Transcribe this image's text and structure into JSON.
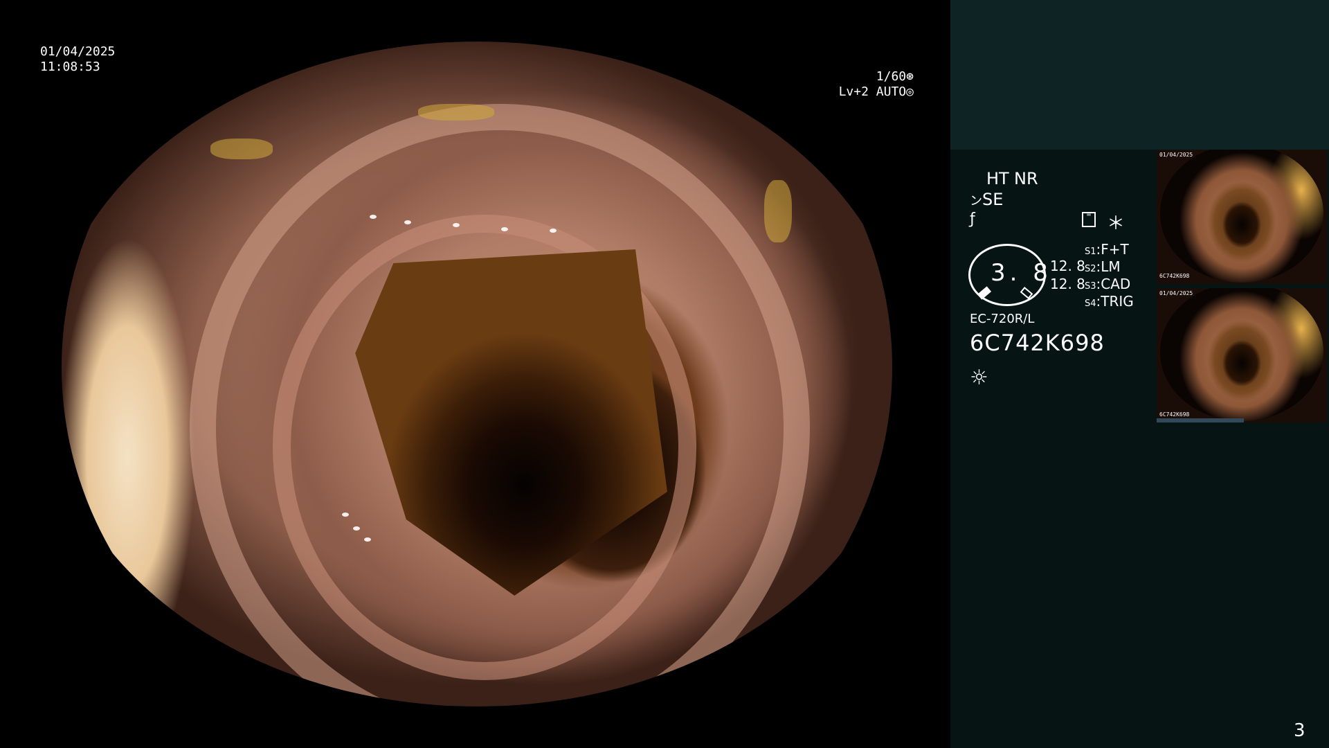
{
  "overlay": {
    "date": "01/04/2025",
    "time": "11:08:53",
    "shutter": "1/60",
    "shutter_icon": "aperture-icon",
    "exposure_level": "Lv+2",
    "exposure_mode": "AUTO",
    "exposure_icon": "iris-icon"
  },
  "sidebar": {
    "mode_ht": "HT",
    "mode_nr": "NR",
    "mode_se_prefix": "ン",
    "mode_se": "SE",
    "hook_glyph": "ƒ",
    "menu_icon": "menu-icon",
    "star_glyph": "＊",
    "dial_value": "3. 8",
    "level_a": "12. 8",
    "level_b": "12. 8",
    "switches": [
      {
        "key": "S1",
        "value": "F+T"
      },
      {
        "key": "S2",
        "value": "LM"
      },
      {
        "key": "S3",
        "value": "CAD"
      },
      {
        "key": "S4",
        "value": "TRIG"
      }
    ],
    "scope_model": "EC-720R/L",
    "scope_serial": "6C742K698",
    "light_icon": "light-source-icon",
    "page_number": "3"
  },
  "thumbnails": [
    {
      "tag_top": "01/04/2025",
      "tag_bottom": "6C742K698"
    },
    {
      "tag_top": "01/04/2025",
      "tag_bottom": "6C742K698"
    }
  ],
  "colors": {
    "highlight_yellow": "#f3c02d",
    "sidebar_bg": "#061514",
    "sidebar_top_bg": "#0e2324"
  }
}
